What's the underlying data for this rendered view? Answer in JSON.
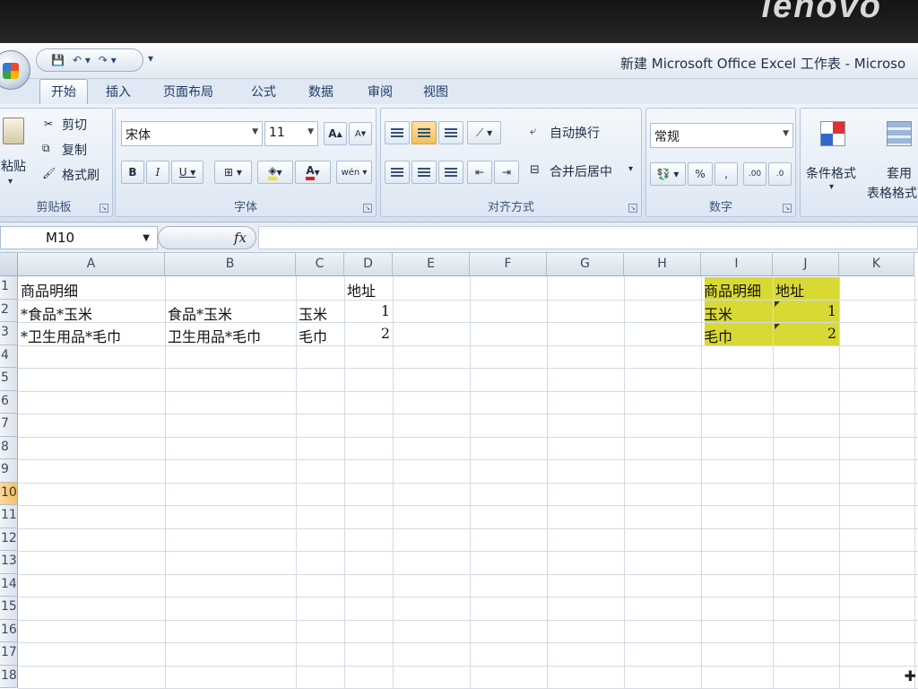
{
  "brand": "lenovo",
  "window_title": "新建 Microsoft Office Excel 工作表 - Microso",
  "tabs": [
    "开始",
    "插入",
    "页面布局",
    "公式",
    "数据",
    "审阅",
    "视图"
  ],
  "clipboard": {
    "paste": "粘贴",
    "cut": "剪切",
    "copy": "复制",
    "format_painter": "格式刷",
    "label": "剪贴板"
  },
  "font": {
    "name": "宋体",
    "size": "11",
    "label": "字体"
  },
  "alignment": {
    "wrap_text": "自动换行",
    "merge_center": "合并后居中",
    "label": "对齐方式"
  },
  "number": {
    "format": "常规",
    "label": "数字"
  },
  "styles": {
    "conditional": "条件格式",
    "table_format_1": "套用",
    "table_format_2": "表格格式"
  },
  "name_box": "M10",
  "columns": [
    "A",
    "B",
    "C",
    "D",
    "E",
    "F",
    "G",
    "H",
    "I",
    "J",
    "K"
  ],
  "rows": [
    "1",
    "2",
    "3",
    "4",
    "5",
    "6",
    "7",
    "8",
    "9",
    "10",
    "11",
    "12",
    "13",
    "14",
    "15",
    "16",
    "17",
    "18"
  ],
  "selected_row": "10",
  "highlight_color": "#d9d936",
  "cells": {
    "A1": "商品明细",
    "D1": "地址",
    "A2": "*食品*玉米",
    "B2": "食品*玉米",
    "C2": "玉米",
    "D2": "1",
    "A3": "*卫生用品*毛巾",
    "B3": "卫生用品*毛巾",
    "C3": "毛巾",
    "D3": "2",
    "I1": "商品明细",
    "J1": "地址",
    "I2": "玉米",
    "J2": "1",
    "I3": "毛巾",
    "J3": "2"
  }
}
